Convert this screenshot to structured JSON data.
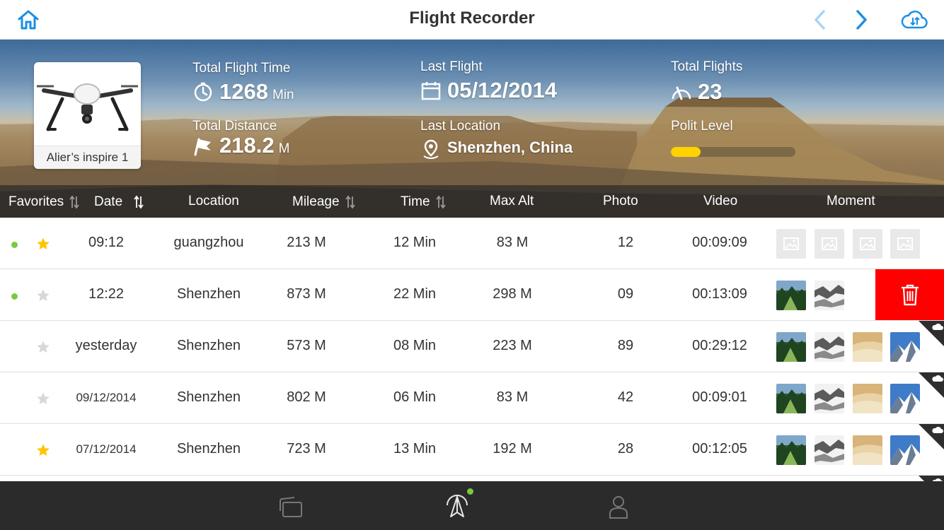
{
  "header": {
    "title": "Flight Recorder"
  },
  "hero": {
    "aircraft_name": "Alier’s inspire 1",
    "total_flight_time": {
      "label": "Total Flight Time",
      "value": "1268",
      "unit": "Min"
    },
    "total_distance": {
      "label": "Total Distance",
      "value": "218.2",
      "unit": "M"
    },
    "last_flight": {
      "label": "Last Flight",
      "value": "05/12/2014"
    },
    "last_location": {
      "label": "Last Location",
      "value": "Shenzhen, China"
    },
    "total_flights": {
      "label": "Total Flights",
      "value": "23"
    },
    "pilot_level": {
      "label": "Polit Level",
      "progress": 0.24,
      "color": "#ffd200"
    }
  },
  "columns": {
    "favorites": "Favorites",
    "date": "Date",
    "location": "Location",
    "mileage": "Mileage",
    "time": "Time",
    "max_alt": "Max Alt",
    "photo": "Photo",
    "video": "Video",
    "moment": "Moment"
  },
  "rows": [
    {
      "new": true,
      "favorite": true,
      "date": "09:12",
      "location": "guangzhou",
      "mileage": "213 M",
      "time": "12 Min",
      "max_alt": "83 M",
      "photo": "12",
      "video": "00:09:09",
      "moments": [
        "placeholder",
        "placeholder",
        "placeholder",
        "placeholder"
      ],
      "cloud": false,
      "delete": false
    },
    {
      "new": true,
      "favorite": false,
      "date": "12:22",
      "location": "Shenzhen",
      "mileage": "873 M",
      "time": "22 Min",
      "max_alt": "298 M",
      "photo": "09",
      "video": "00:13:09",
      "moments": [
        "forest",
        "snow"
      ],
      "cloud": false,
      "delete": true
    },
    {
      "new": false,
      "favorite": false,
      "date": "yesterday",
      "location": "Shenzhen",
      "mileage": "573 M",
      "time": "08 Min",
      "max_alt": "223 M",
      "photo": "89",
      "video": "00:29:12",
      "moments": [
        "forest",
        "snow",
        "desert",
        "mountain"
      ],
      "cloud": true,
      "delete": false
    },
    {
      "new": false,
      "favorite": false,
      "date": "09/12/2014",
      "location": "Shenzhen",
      "mileage": "802 M",
      "time": "06 Min",
      "max_alt": "83 M",
      "photo": "42",
      "video": "00:09:01",
      "moments": [
        "forest",
        "snow",
        "desert",
        "mountain"
      ],
      "cloud": true,
      "delete": false
    },
    {
      "new": false,
      "favorite": true,
      "date": "07/12/2014",
      "location": "Shenzhen",
      "mileage": "723 M",
      "time": "13 Min",
      "max_alt": "192 M",
      "photo": "28",
      "video": "00:12:05",
      "moments": [
        "forest",
        "snow",
        "desert",
        "mountain"
      ],
      "cloud": true,
      "delete": false
    }
  ],
  "icons": {
    "home": "home-icon",
    "prev": "chevron-left-icon",
    "next": "chevron-right-icon",
    "cloud_sync": "cloud-sync-icon",
    "delete": "trash-icon",
    "tabs": [
      "album-icon",
      "aircraft-icon",
      "user-icon"
    ]
  },
  "colors": {
    "accent": "#1a8fe3",
    "accent_disabled": "#a9d3f5",
    "favorite": "#ffc400",
    "favorite_off": "#d8d8d8",
    "new_dot": "#7ac943",
    "delete": "#ff0000",
    "bottom_bar": "#2b2b2b"
  }
}
